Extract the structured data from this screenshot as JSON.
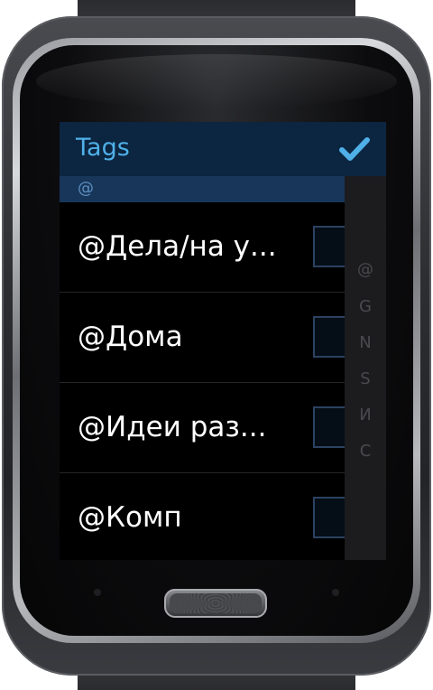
{
  "header": {
    "title": "Tags",
    "confirm_icon": "checkmark-icon"
  },
  "section": {
    "label": "@"
  },
  "index_letters": [
    "@",
    "G",
    "N",
    "S",
    "И",
    "C"
  ],
  "tags": [
    {
      "label": "@Дела/на у...",
      "checked": false
    },
    {
      "label": "@Дома",
      "checked": false
    },
    {
      "label": "@Идеи раз...",
      "checked": false
    },
    {
      "label": "@Комп",
      "checked": false
    }
  ],
  "colors": {
    "header_bg": "#0c2540",
    "title_text": "#4fb0e8",
    "section_bg": "#17365a",
    "accent": "#4fb0e8"
  }
}
